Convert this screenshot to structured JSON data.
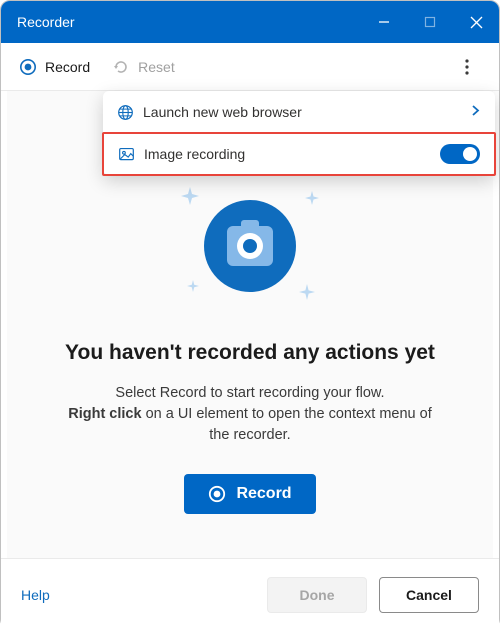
{
  "window": {
    "title": "Recorder"
  },
  "toolbar": {
    "record_label": "Record",
    "reset_label": "Reset"
  },
  "menu": {
    "launch_label": "Launch new web browser",
    "image_recording_label": "Image recording",
    "image_recording_on": true
  },
  "empty": {
    "title": "You haven't recorded any actions yet",
    "line1": "Select Record to start recording your flow.",
    "bold": "Right click",
    "line2_rest": " on a UI element to open the context menu of the recorder.",
    "record_button": "Record"
  },
  "footer": {
    "help": "Help",
    "done": "Done",
    "cancel": "Cancel"
  },
  "colors": {
    "accent": "#0067c5"
  }
}
